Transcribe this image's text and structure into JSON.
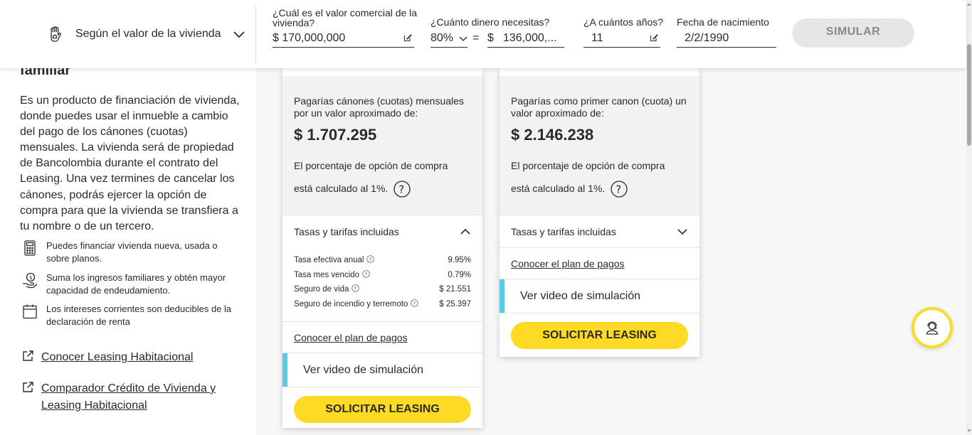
{
  "left": {
    "heading": "familiar",
    "description": "Es un producto de financiación de vivienda, donde puedes usar el inmueble a cambio del pago de los cánones (cuotas) mensuales. La vivienda será de propiedad de Bancolombia durante el contrato del Leasing. Una vez termines de cancelar los cánones, podrás ejercer la opción de compra para que la vivienda se transfiera a tu nombre o de un tercero.",
    "features": [
      {
        "icon": "calculator-icon",
        "text": "Puedes financiar vivienda nueva, usada o sobre planos."
      },
      {
        "icon": "money-hand-icon",
        "text": "Suma los ingresos familiares y obtén mayor capacidad de endeudamiento."
      },
      {
        "icon": "calendar-icon",
        "text": "Los intereses corrientes son deducibles de la declaración de renta"
      }
    ],
    "links": [
      {
        "icon": "external-link-icon",
        "text": "Conocer Leasing Habitacional"
      },
      {
        "icon": "external-link-icon",
        "text": "Comparador Crédito de Vivienda y Leasing Habitacional"
      }
    ]
  },
  "topbar": {
    "mode_label": "Según el valor de la vivienda",
    "property_value_label": "¿Cuál es el valor comercial de la vivienda?",
    "property_value": "$ 170,000,000",
    "money_needed_label": "¿Cuánto dinero necesitas?",
    "percent": "80%",
    "equals": "=",
    "currency": "$",
    "money_needed": "136,000,...",
    "years_label": "¿A cuántos años?",
    "years": "11",
    "birthdate_label": "Fecha de nacimiento",
    "birthdate": "2/2/1990",
    "simulate": "SIMULAR"
  },
  "cards": [
    {
      "payment_label": "Pagarías cánones (cuotas) mensuales por un valor aproximado de:",
      "amount": "$ 1.707.295",
      "purchase_option_1": "El porcentaje de opción de compra",
      "purchase_option_2": "está calculado al 1%.",
      "rates_title": "Tasas y tarifas incluidas",
      "rates": [
        {
          "label": "Tasa efectiva anual",
          "value": "9.95%"
        },
        {
          "label": "Tasa mes vencido",
          "value": "0.79%"
        },
        {
          "label": "Seguro de vida",
          "value": "$ 21.551"
        },
        {
          "label": "Seguro de incendio y terremoto",
          "value": "$ 25.397"
        }
      ],
      "plan_link": "Conocer el plan de pagos",
      "video": "Ver video de simulación",
      "apply": "SOLICITAR LEASING"
    },
    {
      "payment_label": "Pagarías como primer canon (cuota) un valor aproximado de:",
      "amount": "$ 2.146.238",
      "purchase_option_1": "El porcentaje de opción de compra",
      "purchase_option_2": "está calculado al 1%.",
      "rates_title": "Tasas y tarifas incluidas",
      "plan_link": "Conocer el plan de pagos",
      "video": "Ver video de simulación",
      "apply": "SOLICITAR LEASING"
    }
  ],
  "colors": {
    "accent_yellow": "#fdda24",
    "video_bar": "#59cbe8",
    "text": "#2c2a29"
  }
}
